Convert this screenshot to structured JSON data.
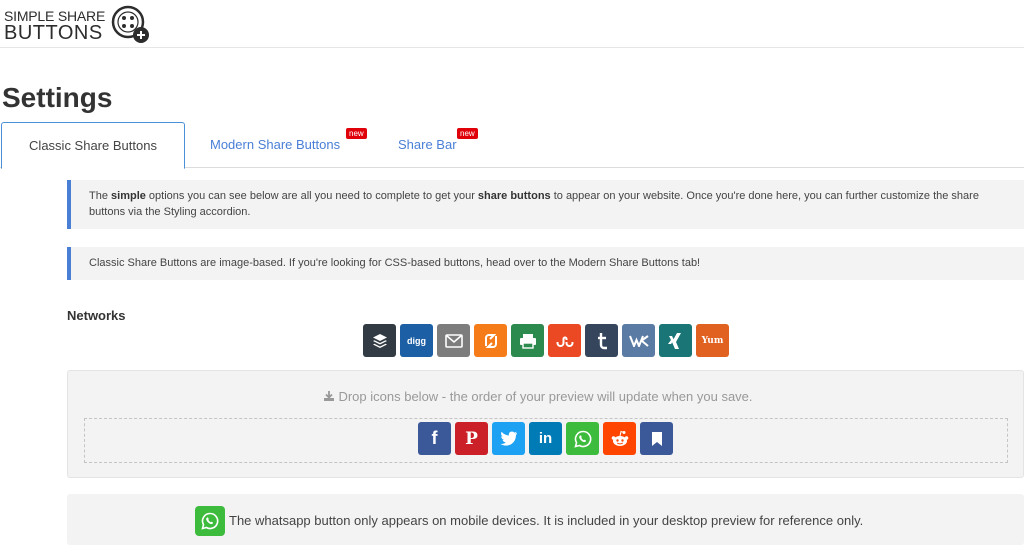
{
  "logo": {
    "line1": "SIMPLE SHARE",
    "line2": "BUTTONS"
  },
  "page": {
    "title": "Settings"
  },
  "tabs": [
    {
      "label": "Classic Share Buttons",
      "active": true
    },
    {
      "label": "Modern Share Buttons",
      "badge": "new"
    },
    {
      "label": "Share Bar",
      "badge": "new"
    }
  ],
  "notices": {
    "simple": {
      "part1": "The ",
      "bold1": "simple",
      "part2": " options you can see below are all you need to complete to get your ",
      "bold2": "share buttons",
      "part3": " to appear on your website. Once you're done here, you can further customize the share buttons via the Styling accordion."
    },
    "classic": "Classic Share Buttons are image-based. If you're looking for CSS-based buttons, head over to the Modern Share Buttons tab!"
  },
  "networks": {
    "label": "Networks",
    "available": [
      {
        "name": "buffer",
        "icon": "buffer-icon",
        "color": "#323b43"
      },
      {
        "name": "digg",
        "icon": "digg-icon",
        "color": "#1d5fa5",
        "text": "digg"
      },
      {
        "name": "email",
        "icon": "email-icon",
        "color": "#7d7d7d"
      },
      {
        "name": "flattr",
        "icon": "flattr-icon",
        "color": "#f67c1a"
      },
      {
        "name": "print",
        "icon": "print-icon",
        "color": "#2d8a4e"
      },
      {
        "name": "stumbleupon",
        "icon": "stumbleupon-icon",
        "color": "#eb4924"
      },
      {
        "name": "tumblr",
        "icon": "tumblr-icon",
        "color": "#35465c"
      },
      {
        "name": "vk",
        "icon": "vk-icon",
        "color": "#5a7ba4"
      },
      {
        "name": "xing",
        "icon": "xing-icon",
        "color": "#1a7576"
      },
      {
        "name": "yummly",
        "icon": "yummly-icon",
        "color": "#e16120",
        "text": "Yum"
      }
    ],
    "drop_hint": "Drop icons below - the order of your preview will update when you save.",
    "selected": [
      {
        "name": "facebook",
        "icon": "facebook-icon",
        "color": "#3b5998",
        "text": "f"
      },
      {
        "name": "pinterest",
        "icon": "pinterest-icon",
        "color": "#cb2027",
        "text": "P"
      },
      {
        "name": "twitter",
        "icon": "twitter-icon",
        "color": "#1da1f2"
      },
      {
        "name": "linkedin",
        "icon": "linkedin-icon",
        "color": "#007bb5",
        "text": "in"
      },
      {
        "name": "whatsapp",
        "icon": "whatsapp-icon",
        "color": "#3dbb3d"
      },
      {
        "name": "reddit",
        "icon": "reddit-icon",
        "color": "#ff4500"
      },
      {
        "name": "bookmark",
        "icon": "bookmark-icon",
        "color": "#3b5998"
      }
    ]
  },
  "whatsapp_notice": "The whatsapp button only appears on mobile devices. It is included in your desktop preview for reference only."
}
